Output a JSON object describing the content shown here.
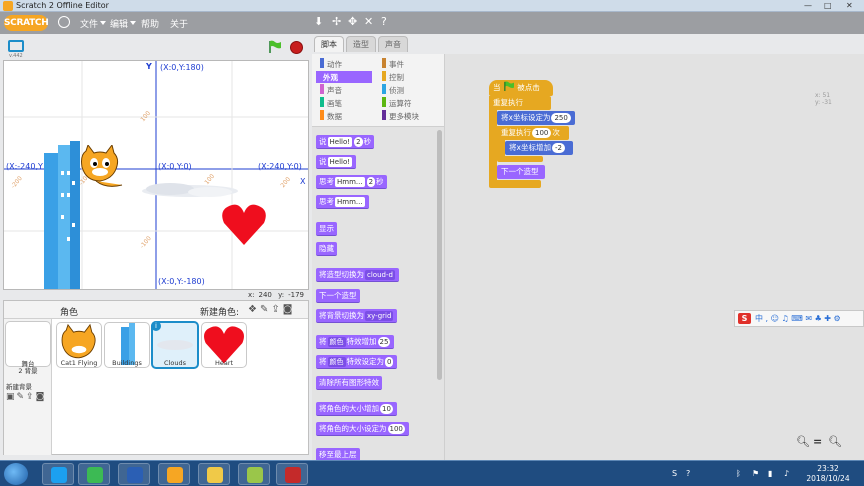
{
  "window": {
    "title": "Scratch 2 Offline Editor"
  },
  "menubar": {
    "logo": "SCRATCH",
    "menus": [
      "文件",
      "编辑",
      "帮助",
      "关于"
    ]
  },
  "stage_header": {
    "version_label": "v.442"
  },
  "stage": {
    "axis_x": "X",
    "axis_y": "Y",
    "coords": {
      "top": "(X:0,Y:180)",
      "left": "(X:-240,Y",
      "center": "(X:0,Y:0)",
      "right": "(X:240,Y:0)",
      "bottom": "(X:0,Y:-180)"
    },
    "grid_labels": [
      "100",
      "-100",
      "100",
      "-100",
      "-200",
      "200"
    ]
  },
  "stage_readout": {
    "x_label": "x:",
    "x_value": "240",
    "y_label": "y:",
    "y_value": "-179"
  },
  "sprite_panel": {
    "title": "角色",
    "new_sprite": "新建角色:",
    "stage_label": "舞台",
    "stage_backdrops": "2 背景",
    "new_backdrop": "新建背景",
    "sprites": [
      {
        "name": "Cat1 Flying"
      },
      {
        "name": "Buildings"
      },
      {
        "name": "Clouds",
        "selected": true
      },
      {
        "name": "Heart"
      }
    ]
  },
  "tabs": [
    "脚本",
    "造型",
    "声音"
  ],
  "categories": [
    {
      "label": "动作",
      "color": "#4a6cd4"
    },
    {
      "label": "外观",
      "color": "#9966ff",
      "active": true
    },
    {
      "label": "声音",
      "color": "#cf63cf"
    },
    {
      "label": "画笔",
      "color": "#0fbd8c"
    },
    {
      "label": "数据",
      "color": "#ff8c1a"
    },
    {
      "label": "事件",
      "color": "#c88330"
    },
    {
      "label": "控制",
      "color": "#e6a821"
    },
    {
      "label": "侦测",
      "color": "#2ca5e2"
    },
    {
      "label": "运算符",
      "color": "#5cb712"
    },
    {
      "label": "更多模块",
      "color": "#632d99"
    }
  ],
  "palette": {
    "say_secs": {
      "label": "说",
      "text": "Hello!",
      "num": "2",
      "unit": "秒"
    },
    "say": {
      "label": "说",
      "text": "Hello!"
    },
    "think_secs": {
      "label": "思考",
      "text": "Hmm...",
      "num": "2",
      "unit": "秒"
    },
    "think": {
      "label": "思考",
      "text": "Hmm..."
    },
    "show": "显示",
    "hide": "隐藏",
    "switch_costume": {
      "label": "将造型切换为",
      "value": "cloud-d"
    },
    "next_costume": "下一个造型",
    "switch_backdrop": {
      "label": "将背景切换为",
      "value": "xy-grid"
    },
    "change_effect": {
      "label": "将",
      "effect": "颜色",
      "mid": "特效增加",
      "num": "25"
    },
    "set_effect": {
      "label": "将",
      "effect": "颜色",
      "mid": "特效设定为",
      "num": "0"
    },
    "clear_effects": "清除所有图形特效",
    "change_size": {
      "label": "将角色的大小增加",
      "num": "10"
    },
    "set_size": {
      "label": "将角色的大小设定为",
      "num": "100"
    },
    "front": "移至最上层"
  },
  "script": {
    "hat": {
      "pre": "当",
      "post": "被点击"
    },
    "forever": "重复执行",
    "set_x": {
      "label": "将x坐标设定为",
      "value": "250"
    },
    "repeat": {
      "label": "重复执行",
      "value": "100",
      "unit": "次"
    },
    "change_x": {
      "label": "将x坐标增加",
      "value": "-2"
    },
    "next_costume": "下一个造型",
    "sprite_xy": {
      "x": "x: 51",
      "y": "y: -31"
    }
  },
  "ime": {
    "label": "中"
  },
  "taskbar": {
    "time": "23:32",
    "date": "2018/10/24"
  },
  "colors": {
    "looks": "#9966ff",
    "control": "#e6a821",
    "motion": "#4a6cd4",
    "menubar": "#9c9ea2",
    "coord": "#1d3cd1"
  }
}
